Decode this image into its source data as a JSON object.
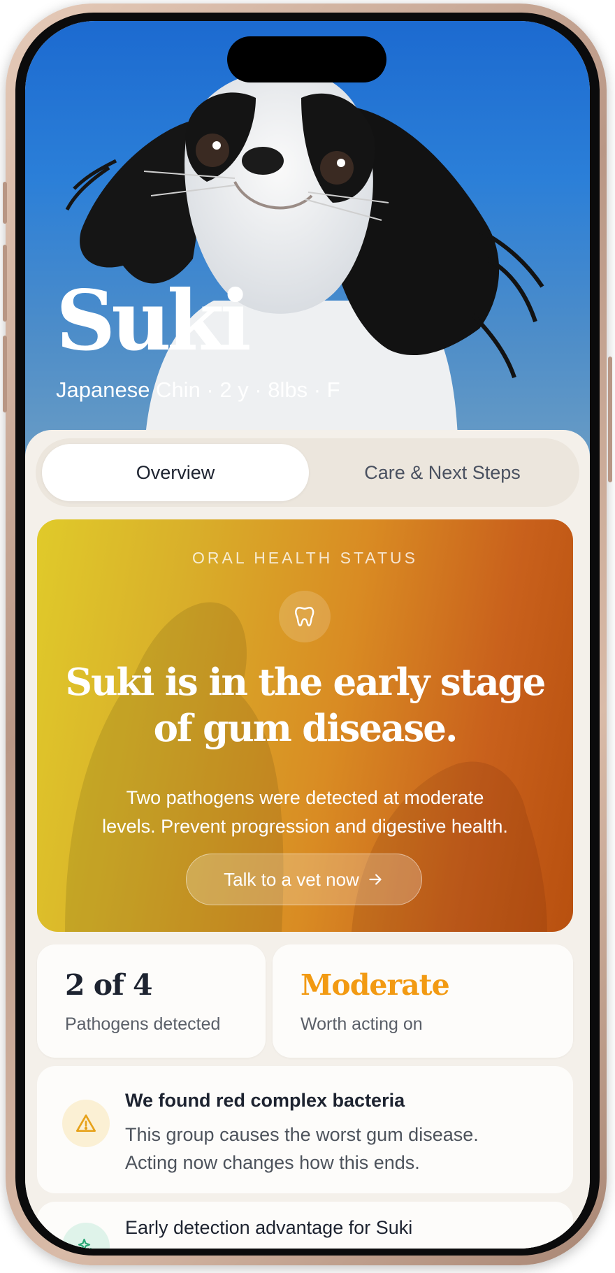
{
  "hero": {
    "pet_name": "Suki",
    "pet_meta": "Japanese Chin · 2 y · 8lbs · F"
  },
  "tabs": [
    {
      "label": "Overview",
      "active": true
    },
    {
      "label": "Care & Next Steps",
      "active": false
    }
  ],
  "status_card": {
    "label": "ORAL HEALTH STATUS",
    "icon": "tooth-icon",
    "headline_line1": "Suki is in the early stage",
    "headline_line2": "of gum disease.",
    "body_line1": "Two pathogens were detected at moderate",
    "body_line2": "levels. Prevent progression and digestive health.",
    "button_label": "Talk to a vet now",
    "button_icon": "arrow-right-icon",
    "gradient": [
      "#e0ca2a",
      "#d98b23",
      "#b8500f"
    ]
  },
  "stats": [
    {
      "value": "2 of 4",
      "caption": "Pathogens detected",
      "color": "#1d2330"
    },
    {
      "value": "Moderate",
      "caption": "Worth acting on",
      "color": "#f29a12"
    }
  ],
  "alert": {
    "icon": "warning-icon",
    "title": "We found red complex bacteria",
    "body_line1": "This group causes the worst gum disease.",
    "body_line2": "Acting now changes how this ends."
  },
  "advantage": {
    "icon": "sparkle-icon",
    "title": "Early detection advantage for Suki"
  }
}
